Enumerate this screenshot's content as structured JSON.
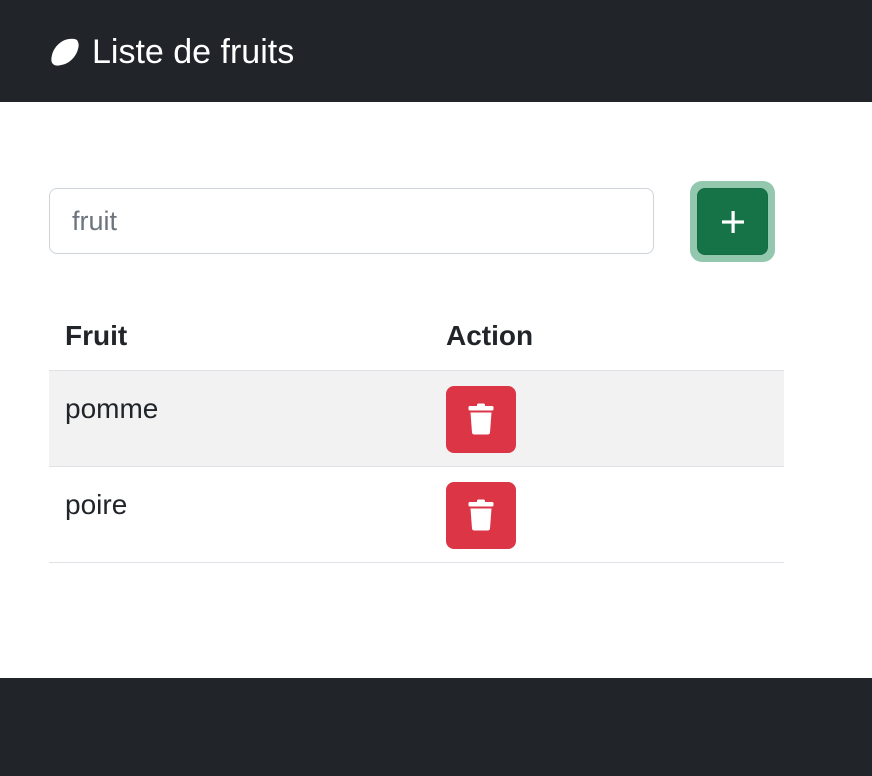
{
  "navbar": {
    "brand_icon": "lemon-icon",
    "title": "Liste de fruits"
  },
  "form": {
    "input_placeholder": "fruit",
    "input_value": "",
    "add_button_icon": "plus-icon"
  },
  "table": {
    "headers": [
      "Fruit",
      "Action"
    ],
    "rows": [
      {
        "fruit": "pomme",
        "action_icon": "trash-icon"
      },
      {
        "fruit": "poire",
        "action_icon": "trash-icon"
      }
    ]
  },
  "colors": {
    "navbar_bg": "#212529",
    "add_button": "#157347",
    "delete_button": "#dc3545",
    "striped_row": "#f2f2f2"
  }
}
